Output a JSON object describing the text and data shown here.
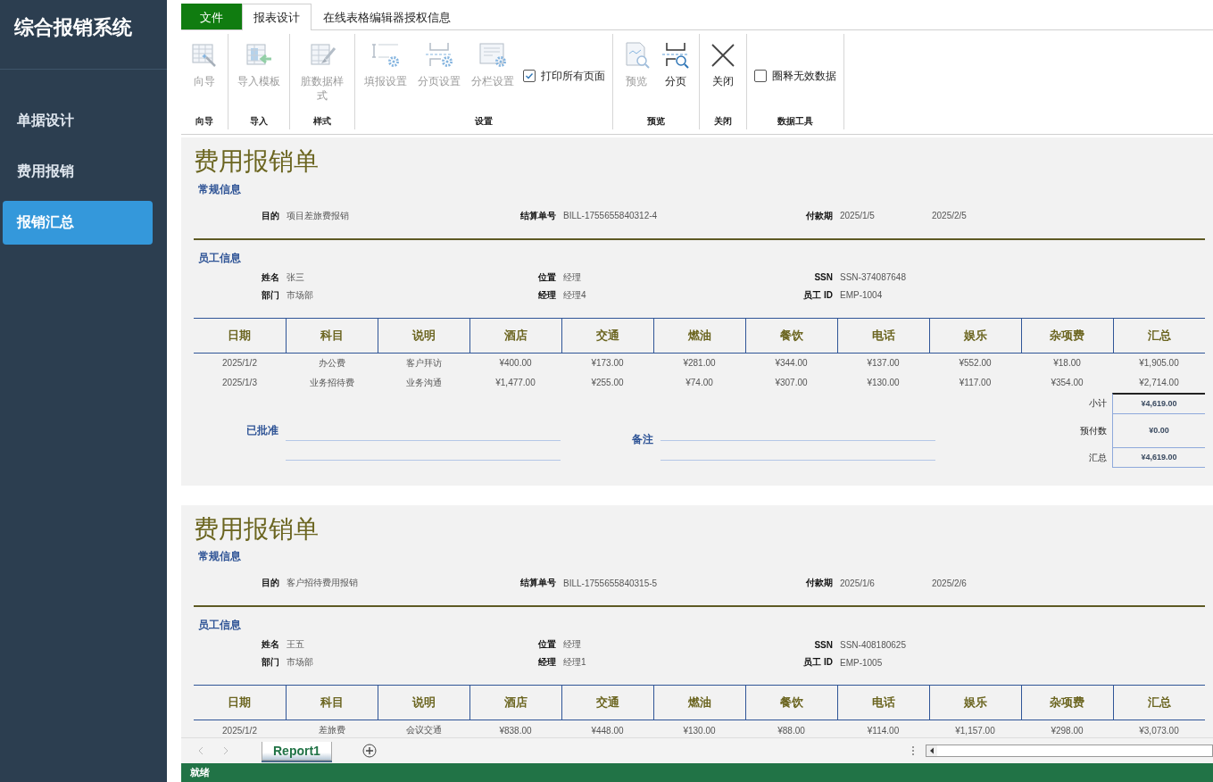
{
  "sidebar": {
    "title": "综合报销系统",
    "items": [
      {
        "label": "单据设计",
        "selected": false
      },
      {
        "label": "费用报销",
        "selected": false
      },
      {
        "label": "报销汇总",
        "selected": true
      }
    ]
  },
  "ribbon": {
    "tabs": [
      {
        "label": "文件",
        "kind": "file",
        "selected": false
      },
      {
        "label": "报表设计",
        "kind": "tab",
        "selected": true
      },
      {
        "label": "在线表格编辑器授权信息",
        "kind": "tab",
        "selected": false
      }
    ],
    "groups": [
      {
        "label": "向导",
        "items": [
          {
            "kind": "button",
            "label": "向导",
            "disabled": true
          }
        ]
      },
      {
        "label": "导入",
        "items": [
          {
            "kind": "button",
            "label": "导入模板",
            "disabled": true
          }
        ]
      },
      {
        "label": "样式",
        "items": [
          {
            "kind": "button",
            "label": "脏数据样式",
            "disabled": true
          }
        ]
      },
      {
        "label": "设置",
        "items": [
          {
            "kind": "button",
            "label": "填报设置",
            "disabled": true
          },
          {
            "kind": "button",
            "label": "分页设置",
            "disabled": true
          },
          {
            "kind": "button",
            "label": "分栏设置",
            "disabled": true
          },
          {
            "kind": "checkbox",
            "label": "打印所有页面",
            "checked": true
          }
        ]
      },
      {
        "label": "预览",
        "items": [
          {
            "kind": "button",
            "label": "预览",
            "disabled": true
          },
          {
            "kind": "button",
            "label": "分页",
            "disabled": false
          }
        ]
      },
      {
        "label": "关闭",
        "items": [
          {
            "kind": "button",
            "label": "关闭",
            "disabled": false
          }
        ]
      },
      {
        "label": "数据工具",
        "items": [
          {
            "kind": "checkbox",
            "label": "圈释无效数据",
            "checked": false
          }
        ]
      }
    ]
  },
  "reports": [
    {
      "title": "费用报销单",
      "general": {
        "heading": "常规信息",
        "fields": [
          {
            "label": "目的",
            "value": "项目差旅费报销"
          },
          {
            "label": "结算单号",
            "value": "BILL-1755655840312-4"
          },
          {
            "label": "付款期",
            "value": "2025/1/5",
            "value_2": "2025/2/5"
          }
        ]
      },
      "employee": {
        "heading": "员工信息",
        "fields": [
          {
            "label": "姓名",
            "value": "张三"
          },
          {
            "label": "位置",
            "value": "经理"
          },
          {
            "label": "SSN",
            "value": "SSN-374087648"
          },
          {
            "label": "部门",
            "value": "市场部"
          },
          {
            "label": "经理",
            "value": "经理4"
          },
          {
            "label": "员工 ID",
            "value": "EMP-1004"
          }
        ]
      },
      "columns": [
        "日期",
        "科目",
        "说明",
        "酒店",
        "交通",
        "燃油",
        "餐饮",
        "电话",
        "娱乐",
        "杂项费",
        "汇总"
      ],
      "rows": [
        [
          "2025/1/2",
          "办公费",
          "客户拜访",
          "¥400.00",
          "¥173.00",
          "¥281.00",
          "¥344.00",
          "¥137.00",
          "¥552.00",
          "¥18.00",
          "¥1,905.00"
        ],
        [
          "2025/1/3",
          "业务招待费",
          "业务沟通",
          "¥1,477.00",
          "¥255.00",
          "¥74.00",
          "¥307.00",
          "¥130.00",
          "¥117.00",
          "¥354.00",
          "¥2,714.00"
        ]
      ],
      "summary": {
        "approved_label": "已批准",
        "notes_label": "备注",
        "totals": [
          {
            "label": "小计",
            "value": "¥4,619.00"
          },
          {
            "label": "预付数",
            "value": "¥0.00"
          },
          {
            "label": "汇总",
            "value": "¥4,619.00"
          }
        ]
      }
    },
    {
      "title": "费用报销单",
      "general": {
        "heading": "常规信息",
        "fields": [
          {
            "label": "目的",
            "value": "客户招待费用报销"
          },
          {
            "label": "结算单号",
            "value": "BILL-1755655840315-5"
          },
          {
            "label": "付款期",
            "value": "2025/1/6",
            "value_2": "2025/2/6"
          }
        ]
      },
      "employee": {
        "heading": "员工信息",
        "fields": [
          {
            "label": "姓名",
            "value": "王五"
          },
          {
            "label": "位置",
            "value": "经理"
          },
          {
            "label": "SSN",
            "value": "SSN-408180625"
          },
          {
            "label": "部门",
            "value": "市场部"
          },
          {
            "label": "经理",
            "value": "经理1"
          },
          {
            "label": "员工 ID",
            "value": "EMP-1005"
          }
        ]
      },
      "columns": [
        "日期",
        "科目",
        "说明",
        "酒店",
        "交通",
        "燃油",
        "餐饮",
        "电话",
        "娱乐",
        "杂项费",
        "汇总"
      ],
      "rows": [
        [
          "2025/1/2",
          "差旅费",
          "会议交通",
          "¥838.00",
          "¥448.00",
          "¥130.00",
          "¥88.00",
          "¥114.00",
          "¥1,157.00",
          "¥298.00",
          "¥3,073.00"
        ]
      ]
    }
  ],
  "sheet_tabs": [
    {
      "label": "Report1",
      "selected": true
    }
  ],
  "status_bar": "就绪"
}
